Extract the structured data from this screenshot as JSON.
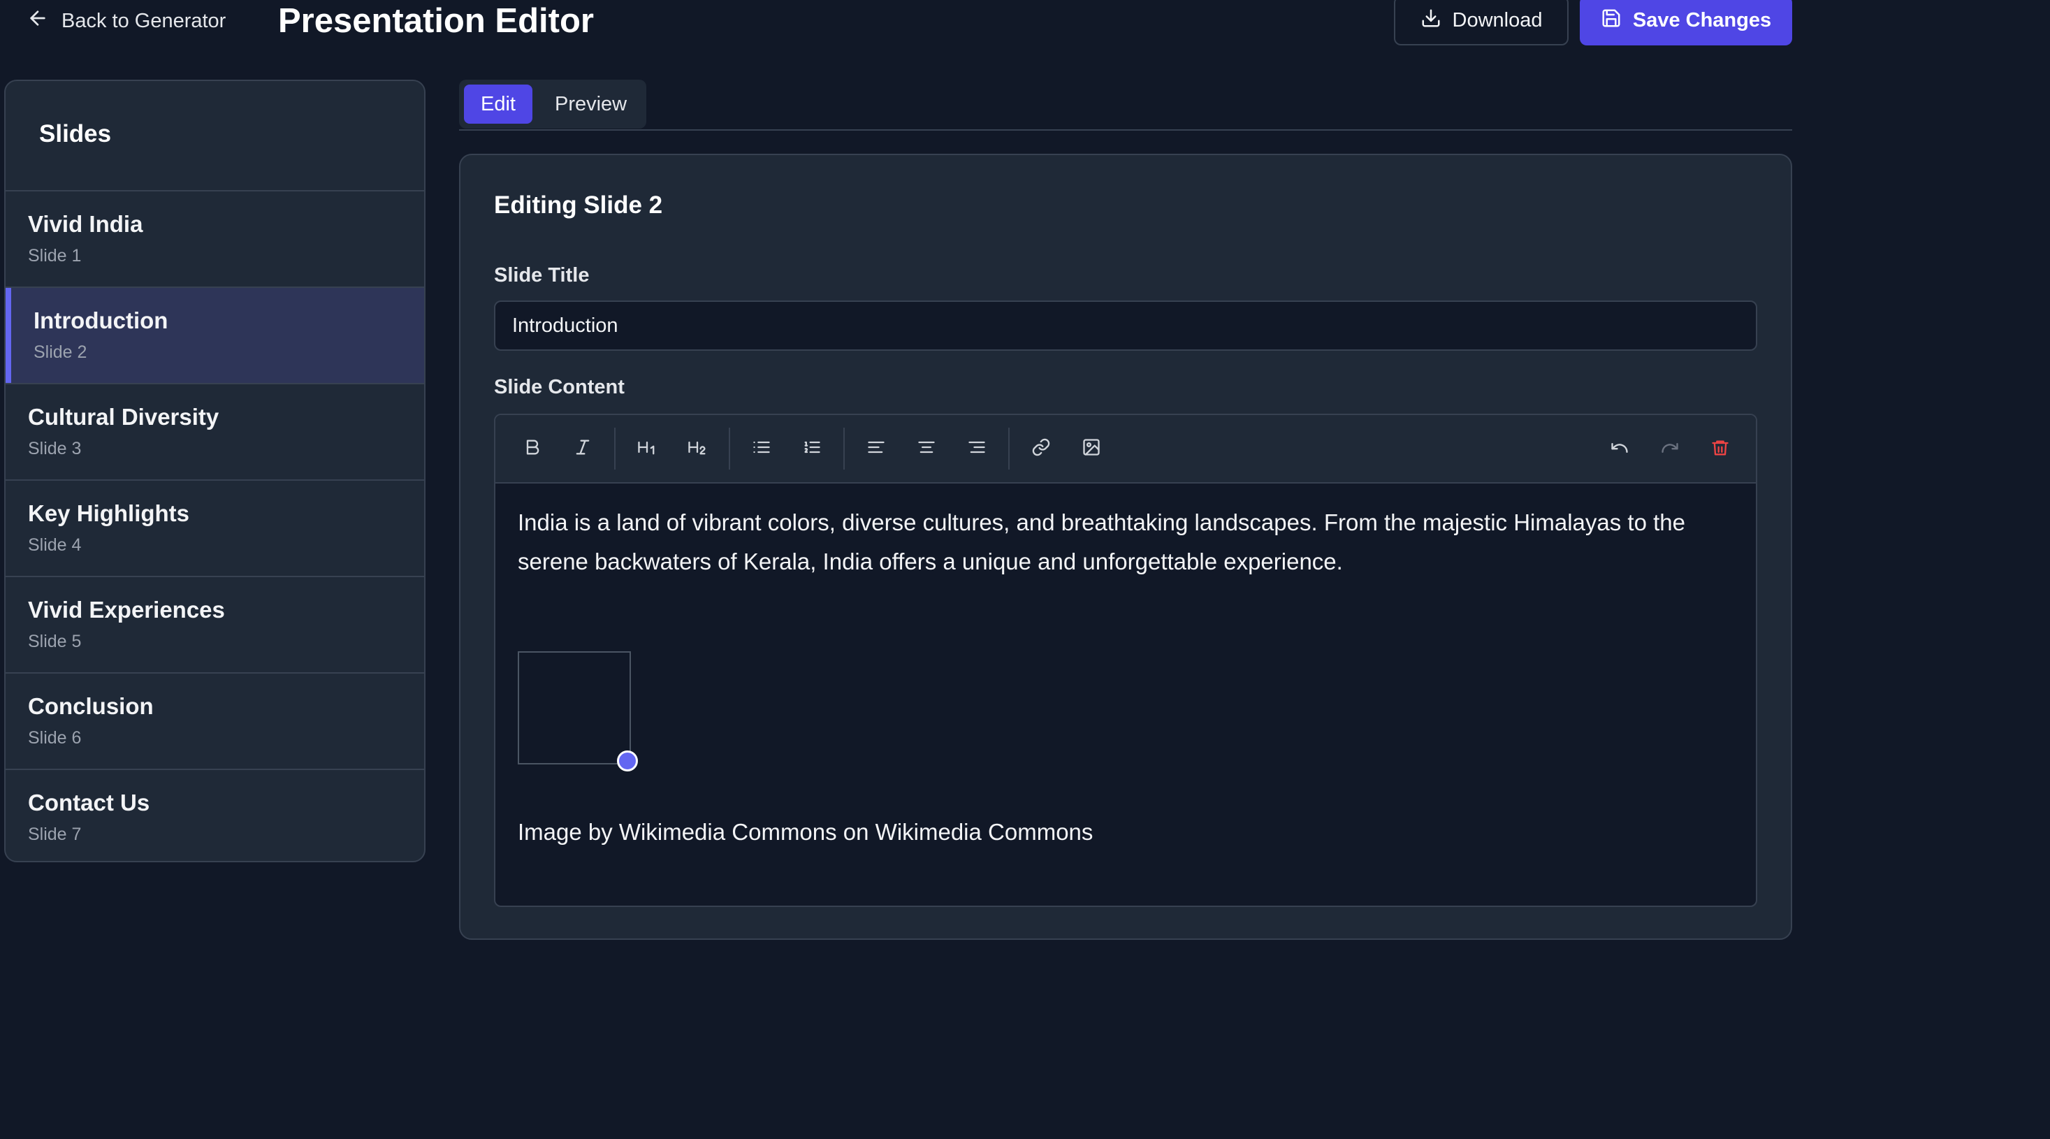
{
  "header": {
    "back_label": "Back to Generator",
    "title": "Presentation Editor",
    "download_label": "Download",
    "save_label": "Save Changes"
  },
  "sidebar": {
    "heading": "Slides",
    "items": [
      {
        "title": "Vivid India",
        "sub": "Slide 1"
      },
      {
        "title": "Introduction",
        "sub": "Slide 2"
      },
      {
        "title": "Cultural Diversity",
        "sub": "Slide 3"
      },
      {
        "title": "Key Highlights",
        "sub": "Slide 4"
      },
      {
        "title": "Vivid Experiences",
        "sub": "Slide 5"
      },
      {
        "title": "Conclusion",
        "sub": "Slide 6"
      },
      {
        "title": "Contact Us",
        "sub": "Slide 7"
      }
    ],
    "active_index": 1
  },
  "tabs": [
    {
      "label": "Edit",
      "active": true
    },
    {
      "label": "Preview",
      "active": false
    }
  ],
  "editor": {
    "heading": "Editing Slide 2",
    "title_label": "Slide Title",
    "title_value": "Introduction",
    "content_label": "Slide Content",
    "body_text": "India is a land of vibrant colors, diverse cultures, and breathtaking landscapes. From the majestic Himalayas to the serene backwaters of Kerala, India offers a unique and unforgettable experience.",
    "image_caption": "Image by Wikimedia Commons on Wikimedia Commons",
    "toolbar_icons": [
      "bold-icon",
      "italic-icon",
      "heading1-icon",
      "heading2-icon",
      "bullet-list-icon",
      "numbered-list-icon",
      "align-left-icon",
      "align-center-icon",
      "align-right-icon",
      "link-icon",
      "image-icon",
      "undo-icon",
      "redo-icon",
      "trash-icon"
    ]
  },
  "colors": {
    "background": "#111827",
    "panel": "#1f2937",
    "accent": "#4f46e5",
    "danger": "#ef4444"
  }
}
